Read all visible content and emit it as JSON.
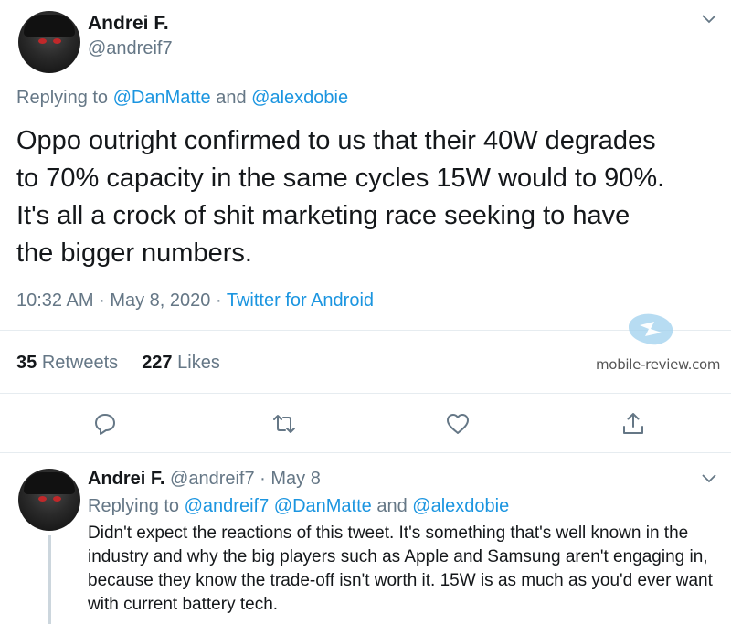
{
  "main_tweet": {
    "author_name": "Andrei F.",
    "author_handle": "@andreif7",
    "replying_prefix": "Replying to",
    "replying_user1": "@DanMatte",
    "replying_and": "and",
    "replying_user2": "@alexdobie",
    "text": "Oppo outright confirmed to us that their 40W degrades\nto 70% capacity in the same cycles 15W would to 90%.\nIt's all a crock of shit marketing race seeking to have\nthe bigger numbers.",
    "time": "10:32 AM",
    "separator": "·",
    "date": "May 8, 2020",
    "source": "Twitter for Android",
    "retweets_count": "35",
    "retweets_label": "Retweets",
    "likes_count": "227",
    "likes_label": "Likes"
  },
  "watermark": {
    "text": "mobile-review.com"
  },
  "reply_tweet": {
    "author_name": "Andrei F.",
    "author_handle": "@andreif7",
    "separator": "·",
    "date": "May 8",
    "replying_prefix": "Replying to",
    "replying_user1": "@andreif7",
    "replying_user2": "@DanMatte",
    "replying_and": "and",
    "replying_user3": "@alexdobie",
    "text": "Didn't expect the reactions of this tweet. It's something that's well known in the industry and why the big players such as Apple and Samsung aren't engaging in, because they know the trade-off isn't worth it. 15W is as much as you'd ever want with current battery tech."
  },
  "icons": {
    "reply": "reply-icon",
    "retweet": "retweet-icon",
    "like": "heart-icon",
    "share": "share-icon",
    "caret": "chevron-down-icon"
  },
  "colors": {
    "link": "#1b95e0",
    "secondary_text": "#657786",
    "primary_text": "#14171a",
    "divider": "#e6ecf0"
  }
}
